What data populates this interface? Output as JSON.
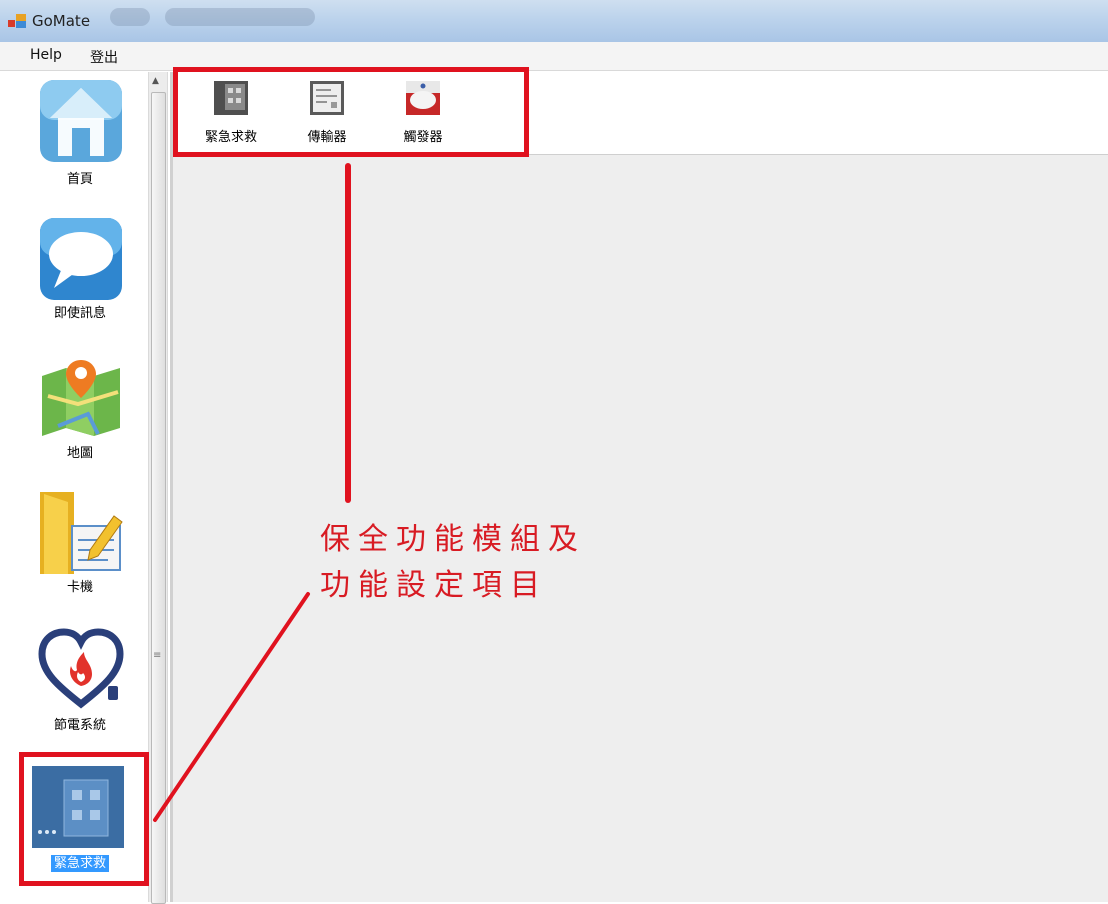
{
  "window": {
    "title": "GoMate"
  },
  "menu": [
    {
      "label": "Help"
    },
    {
      "label": "登出"
    }
  ],
  "sidebar": {
    "items": [
      {
        "label": "首頁",
        "icon": "home-icon",
        "selected": false
      },
      {
        "label": "即使訊息",
        "icon": "chat-bubble-icon",
        "selected": false
      },
      {
        "label": "地圖",
        "icon": "map-icon",
        "selected": false
      },
      {
        "label": "卡機",
        "icon": "door-card-icon",
        "selected": false
      },
      {
        "label": "節電系統",
        "icon": "heart-flame-plug-icon",
        "selected": false
      },
      {
        "label": "緊急求救",
        "icon": "emergency-panel-icon",
        "selected": true
      }
    ]
  },
  "toolbar": {
    "items": [
      {
        "label": "緊急求救",
        "icon": "emergency-device-icon"
      },
      {
        "label": "傳輸器",
        "icon": "transmitter-icon"
      },
      {
        "label": "觸發器",
        "icon": "trigger-alarm-icon"
      }
    ]
  },
  "annotation": {
    "line1": "保全功能模組及",
    "line2": "功能設定項目",
    "color": "#e0121f"
  },
  "colors": {
    "selection": "#3399ff",
    "content_bg": "#eeeeee",
    "titlebar": "#bcd3ec"
  }
}
